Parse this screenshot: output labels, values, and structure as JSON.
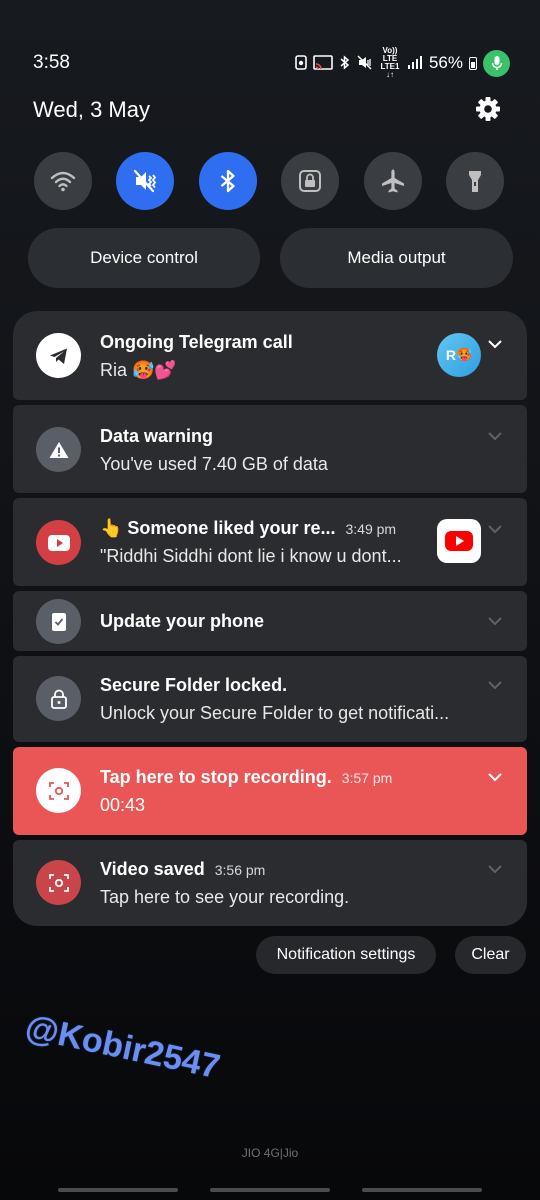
{
  "status_bar": {
    "time": "3:58",
    "network_top": "Vo)) LTE",
    "network_bottom": "LTE1 ↓↑",
    "battery": "56%"
  },
  "header": {
    "date": "Wed, 3 May"
  },
  "quick_toggles": [
    {
      "name": "wifi",
      "icon": "wifi-icon",
      "state": "off"
    },
    {
      "name": "sound",
      "icon": "mute-vibrate-icon",
      "state": "on"
    },
    {
      "name": "bluetooth",
      "icon": "bluetooth-icon",
      "state": "on"
    },
    {
      "name": "screen-lock",
      "icon": "lock-icon",
      "state": "off"
    },
    {
      "name": "airplane",
      "icon": "airplane-icon",
      "state": "off"
    },
    {
      "name": "flashlight",
      "icon": "flashlight-icon",
      "state": "off"
    }
  ],
  "controls": {
    "device_control": "Device control",
    "media_output": "Media output"
  },
  "notifications": [
    {
      "app": "telegram",
      "title": "Ongoing Telegram call",
      "body": "Ria 🥵💕",
      "avatar_letter": "R",
      "avatar_emoji": "🥵"
    },
    {
      "app": "data-usage",
      "title": "Data warning",
      "body": "You've used 7.40 GB of data"
    },
    {
      "app": "youtube",
      "title": "👆 Someone liked your re...",
      "time": "3:49 pm",
      "body": "\"Riddhi Siddhi dont lie i know u dont..."
    },
    {
      "app": "software-update",
      "title": "Update your phone"
    },
    {
      "app": "secure-folder",
      "title": "Secure Folder locked.",
      "body": "Unlock your Secure Folder to get notificati..."
    },
    {
      "app": "screen-recorder",
      "title": "Tap here to stop recording.",
      "time": "3:57 pm",
      "body": "00:43"
    },
    {
      "app": "screen-recorder",
      "title": "Video saved",
      "time": "3:56 pm",
      "body": "Tap here to see your recording."
    }
  ],
  "footer": {
    "notification_settings": "Notification settings",
    "clear": "Clear"
  },
  "watermark": "@Kobir2547",
  "carrier": "JIO 4G|Jio",
  "colors": {
    "accent_blue": "#2f6ef0",
    "recording_red": "#ea5656",
    "card_bg": "#2a2c2f",
    "mic_green": "#3ac26a"
  }
}
